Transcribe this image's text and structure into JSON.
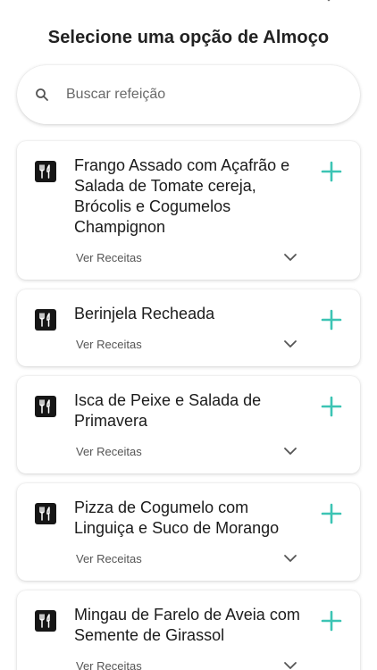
{
  "header": {
    "title": "Selecione uma opção de Almoço",
    "close_icon": "close-icon"
  },
  "search": {
    "placeholder": "Buscar refeição",
    "value": "",
    "icon": "search-icon"
  },
  "meals": [
    {
      "title": "Frango Assado com Açafrão e Salada de Tomate cereja, Brócolis e Cogumelos Champignon",
      "recipes_label": "Ver Receitas"
    },
    {
      "title": "Berinjela Recheada",
      "recipes_label": "Ver Receitas"
    },
    {
      "title": "Isca de Peixe e Salada de Primavera",
      "recipes_label": "Ver Receitas"
    },
    {
      "title": "Pizza de Cogumelo com Linguiça e Suco de Morango",
      "recipes_label": "Ver Receitas"
    },
    {
      "title": "Mingau de Farelo de Aveia com Semente de Girassol",
      "recipes_label": "Ver Receitas"
    }
  ],
  "colors": {
    "accent": "#3cc4b4",
    "meal_icon_bg": "#161616"
  },
  "icons": {
    "meal": "utensils-icon",
    "add": "plus-icon",
    "expand": "chevron-down-icon"
  }
}
